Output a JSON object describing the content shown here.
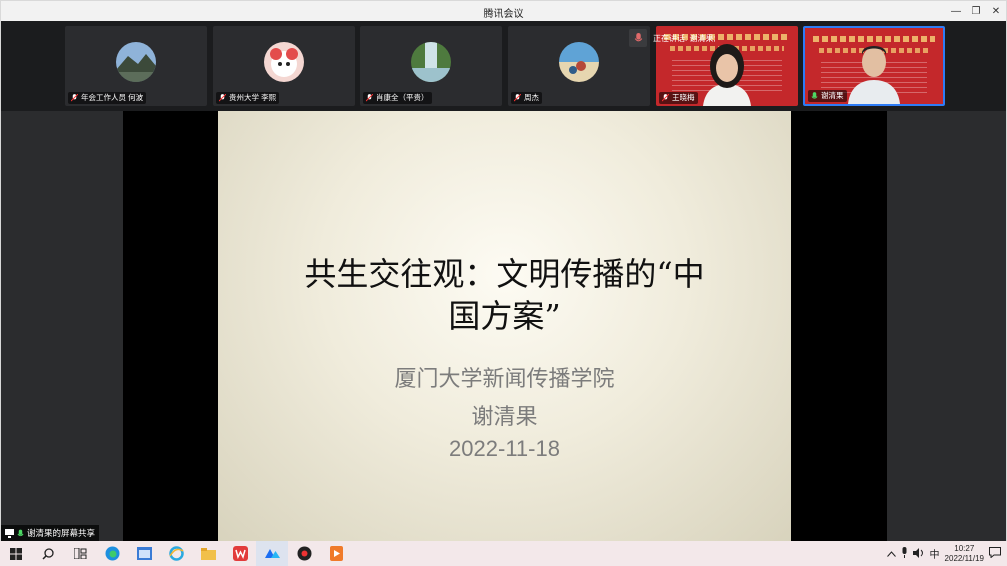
{
  "window": {
    "title": "腾讯会议"
  },
  "speaking": {
    "label": "正在讲话: 谢清果;"
  },
  "participants": [
    {
      "name": "年会工作人员 何波",
      "type": "avatar",
      "avatar": "landscape-avatar"
    },
    {
      "name": "贵州大学 李熙",
      "type": "avatar",
      "avatar": "cartoon-avatar"
    },
    {
      "name": "肖康全（平贵）",
      "type": "avatar",
      "avatar": "waterfall-avatar"
    },
    {
      "name": "周杰",
      "type": "avatar",
      "avatar": "beach-avatar"
    },
    {
      "name": "王晓梅",
      "type": "video",
      "active": false
    },
    {
      "name": "谢清果",
      "type": "video",
      "active": true
    }
  ],
  "slide": {
    "title_line1": "共生交往观：文明传播的“中",
    "title_line2": "国方案”",
    "institution": "厦门大学新闻传播学院",
    "author": "谢清果",
    "date": "2022-11-18"
  },
  "share_notice": "谢清果的屏幕共享",
  "taskbar": {
    "ime": "中",
    "time": "10:27",
    "date": "2022/11/19"
  },
  "colors": {
    "accent": "#2e7cf6",
    "banner": "#c4282b",
    "taskbar": "#f3e8ea"
  }
}
